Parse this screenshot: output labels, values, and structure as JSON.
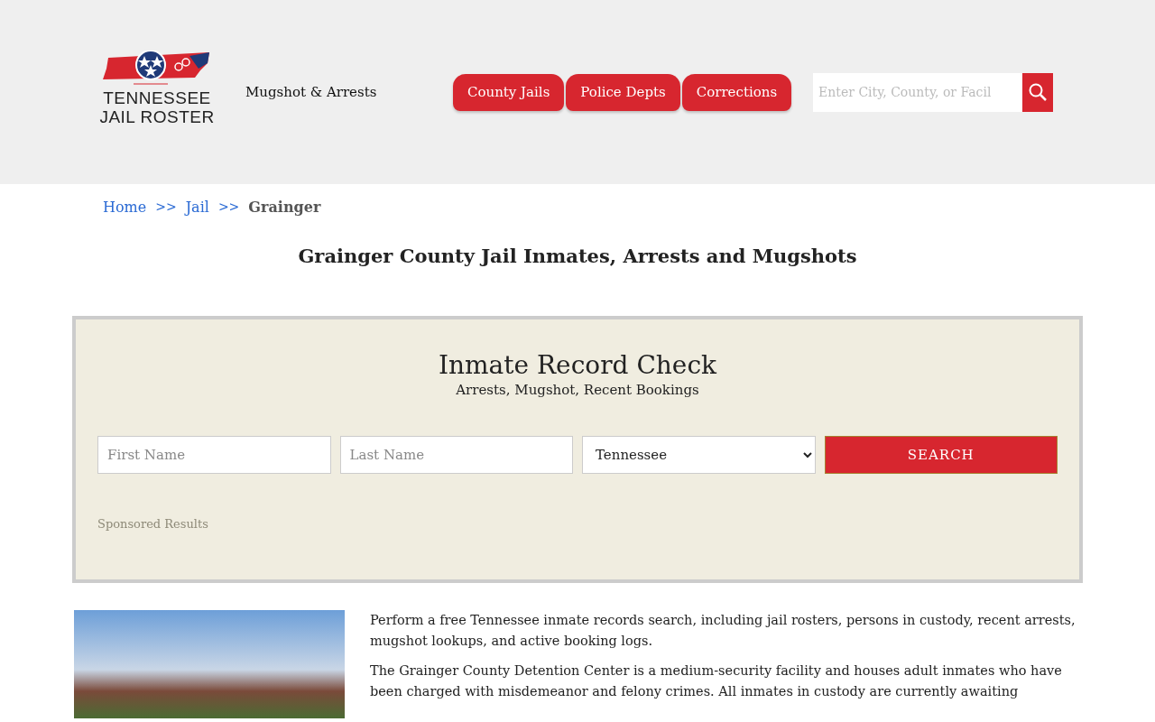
{
  "header": {
    "logo": {
      "line_1": "TENNESSEE",
      "line_2": "JAIL ROSTER"
    },
    "tagline": "Mugshot & Arrests",
    "nav_tabs": [
      {
        "label": "County Jails"
      },
      {
        "label": "Police Depts"
      },
      {
        "label": "Corrections"
      }
    ],
    "search": {
      "placeholder": "Enter City, County, or Facil"
    }
  },
  "breadcrumb": [
    {
      "label": "Home",
      "kind": "link"
    },
    {
      "label": ">>",
      "kind": "separator"
    },
    {
      "label": "Jail",
      "kind": "link"
    },
    {
      "label": ">>",
      "kind": "separator"
    },
    {
      "label": "Grainger",
      "kind": "current"
    }
  ],
  "page_title": "Grainger County Jail Inmates, Arrests and Mugshots",
  "record_check": {
    "title": "Inmate Record Check",
    "subtitle": "Arrests, Mugshot, Recent Bookings",
    "first_name_placeholder": "First Name",
    "last_name_placeholder": "Last Name",
    "state": "Tennessee",
    "button": "SEARCH",
    "sponsored": "Sponsored Results"
  },
  "paragraphs": [
    "Perform a free Tennessee inmate records search, including jail rosters, persons in custody, recent arrests, mugshot lookups, and active booking logs.",
    "The Grainger County Detention Center is a medium-security facility and houses adult inmates who have been charged with misdemeanor and felony crimes. All inmates in custody are currently awaiting"
  ]
}
